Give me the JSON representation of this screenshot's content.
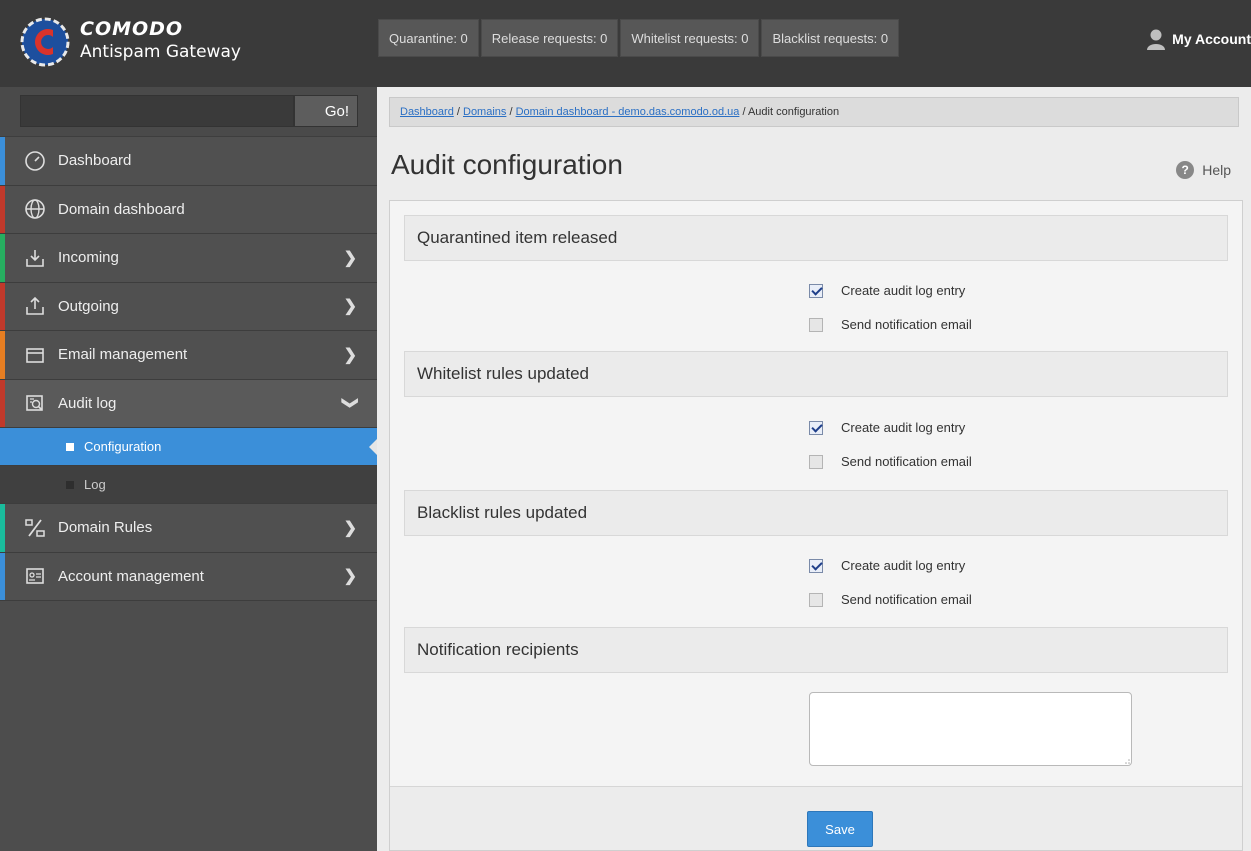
{
  "header": {
    "brand": "COMODO",
    "product": "Antispam Gateway",
    "counters": [
      {
        "label": "Quarantine: 0"
      },
      {
        "label": "Release requests: 0"
      },
      {
        "label": "Whitelist requests: 0"
      },
      {
        "label": "Blacklist requests: 0"
      }
    ],
    "account_label": "My Account"
  },
  "sidebar": {
    "search": {
      "value": "",
      "placeholder": "",
      "button_label": "Go!"
    },
    "items": [
      {
        "label": "Dashboard",
        "icon": "speedometer-icon",
        "stripe": "#3b8fd9"
      },
      {
        "label": "Domain dashboard",
        "icon": "globe-icon",
        "stripe": "#c0392b"
      },
      {
        "label": "Incoming",
        "icon": "inbox-download-icon",
        "stripe": "#27ae60"
      },
      {
        "label": "Outgoing",
        "icon": "inbox-upload-icon",
        "stripe": "#c0392b"
      },
      {
        "label": "Email management",
        "icon": "envelope-icon",
        "stripe": "#e67e22"
      },
      {
        "label": "Audit log",
        "icon": "audit-search-icon",
        "stripe": "#c0392b"
      },
      {
        "label": "Domain Rules",
        "icon": "rules-icon",
        "stripe": "#1abc9c"
      },
      {
        "label": "Account management",
        "icon": "account-card-icon",
        "stripe": "#3b8fd9"
      }
    ],
    "audit_subitems": [
      {
        "label": "Configuration"
      },
      {
        "label": "Log"
      }
    ]
  },
  "breadcrumb": {
    "links": [
      "Dashboard",
      "Domains",
      "Domain dashboard - demo.das.comodo.od.ua"
    ],
    "separator": " / ",
    "current": "Audit configuration"
  },
  "page": {
    "title": "Audit configuration",
    "help_label": "Help"
  },
  "sections": [
    {
      "title": "Quarantined item released",
      "options": [
        {
          "label": "Create audit log entry",
          "checked": true
        },
        {
          "label": "Send notification email",
          "checked": false
        }
      ]
    },
    {
      "title": "Whitelist rules updated",
      "options": [
        {
          "label": "Create audit log entry",
          "checked": true
        },
        {
          "label": "Send notification email",
          "checked": false
        }
      ]
    },
    {
      "title": "Blacklist rules updated",
      "options": [
        {
          "label": "Create audit log entry",
          "checked": true
        },
        {
          "label": "Send notification email",
          "checked": false
        }
      ]
    },
    {
      "title": "Notification recipients",
      "textarea_value": ""
    }
  ],
  "save_label": "Save",
  "colors": {
    "accent": "#3b8fd9",
    "topbar": "#3a3a3a",
    "sidebar": "#4d4d4d"
  }
}
